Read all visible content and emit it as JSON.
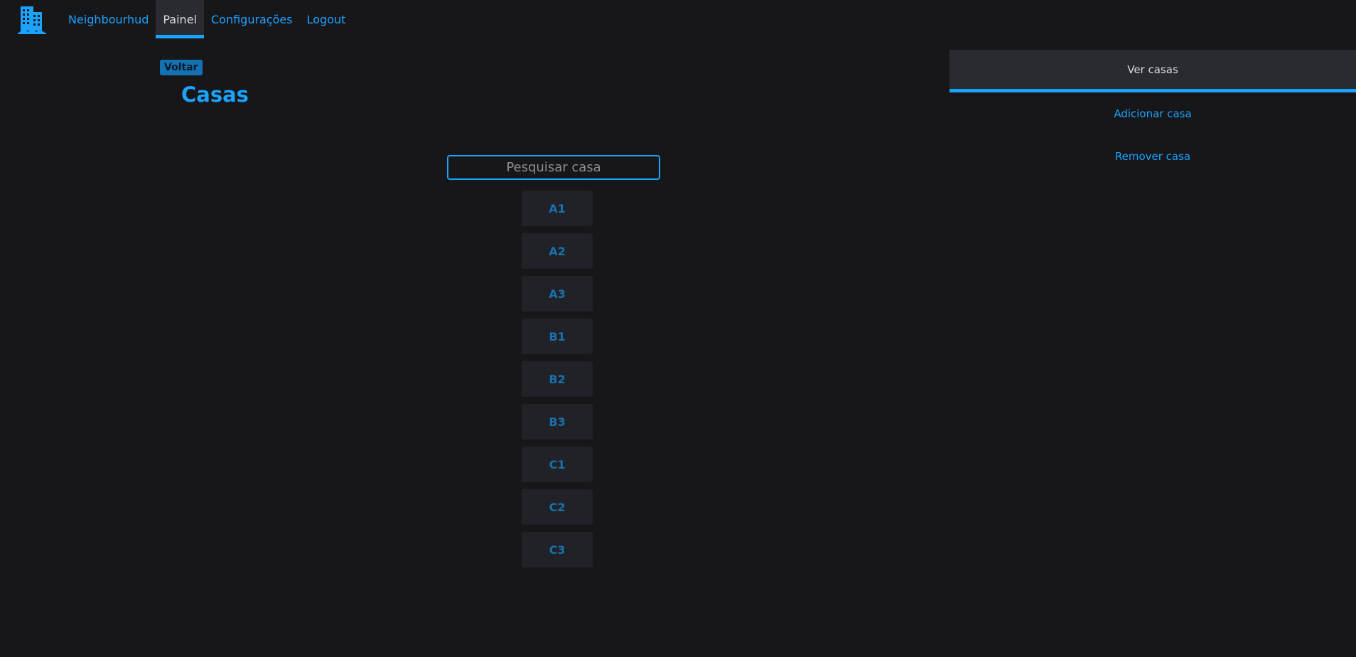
{
  "nav": {
    "logo_icon": "building-icon",
    "links": [
      {
        "label": "Neighbourhud"
      },
      {
        "label": "Painel"
      },
      {
        "label": "Configurações"
      },
      {
        "label": "Logout"
      }
    ],
    "active_index": 1
  },
  "header": {
    "back_label": "Voltar",
    "title": "Casas"
  },
  "search": {
    "placeholder": "Pesquisar casa",
    "value": ""
  },
  "houses": [
    "A1",
    "A2",
    "A3",
    "B1",
    "B2",
    "B3",
    "C1",
    "C2",
    "C3"
  ],
  "side_menu": {
    "items": [
      {
        "label": "Ver casas"
      },
      {
        "label": "Adicionar casa"
      },
      {
        "label": "Remover casa"
      }
    ],
    "active_index": 0
  },
  "colors": {
    "background": "#17171a",
    "accent": "#1aa3ff",
    "panel": "#2a2b31",
    "item": "#212227"
  }
}
